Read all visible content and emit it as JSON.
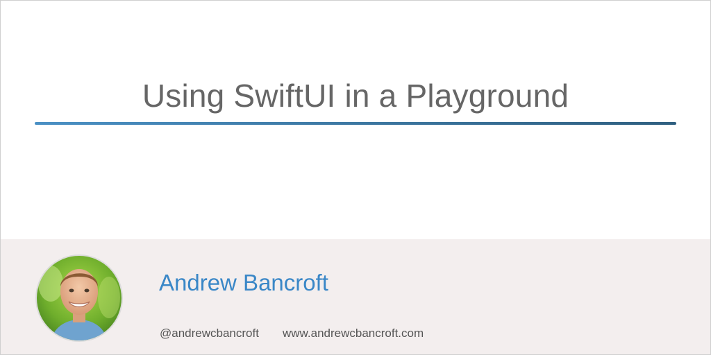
{
  "post": {
    "title": "Using SwiftUI in a Playground"
  },
  "author": {
    "name": "Andrew Bancroft",
    "handle": "@andrewcbancroft",
    "website": "www.andrewcbancroft.com"
  },
  "colors": {
    "title_text": "#666666",
    "author_name": "#3a87c7",
    "rule_start": "#4a90c4",
    "rule_end": "#2f5f80",
    "footer_bg": "#f3eeee",
    "meta_text": "#555555"
  }
}
